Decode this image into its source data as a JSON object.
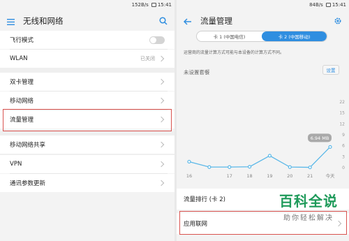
{
  "left": {
    "status": {
      "speed": "152B/s",
      "time": "15:41"
    },
    "title": "无线和网络",
    "rows": [
      {
        "label": "飞行模式",
        "kind": "toggle"
      },
      {
        "label": "WLAN",
        "value": "已关闭"
      },
      {
        "label": "双卡管理"
      },
      {
        "label": "移动网络"
      },
      {
        "label": "流量管理",
        "highlighted": true
      },
      {
        "label": "移动网络共享"
      },
      {
        "label": "VPN"
      },
      {
        "label": "通讯参数更新"
      }
    ]
  },
  "right": {
    "status": {
      "speed": "84B/s",
      "time": "15:41"
    },
    "title": "流量管理",
    "tabs": [
      {
        "label": "卡 1 (中国电信)",
        "active": false
      },
      {
        "label": "卡 2 (中国移动)",
        "active": true
      }
    ],
    "description": "运营商的流量计算方式可能与本设备的计算方式不同。",
    "no_plan": "未设置套餐",
    "set_button": "设置",
    "ranking": "流量排行 (卡 2)",
    "app_network": "应用联网"
  },
  "chart_data": {
    "type": "line",
    "x": [
      "16",
      "17",
      "18",
      "19",
      "20",
      "21",
      "今天"
    ],
    "values": [
      2,
      0.2,
      0.2,
      0.3,
      4,
      0.2,
      0.1,
      6.94
    ],
    "point_labels": [
      "16",
      "",
      "17",
      "18",
      "19",
      "20",
      "21",
      "今天"
    ],
    "yticks": [
      "22",
      "15",
      "12",
      "9",
      "6",
      "3",
      "0"
    ],
    "ylim": [
      0,
      22
    ],
    "last_label": "6.94 MB",
    "color": "#5bb8e8"
  },
  "watermark": {
    "title": "百科全说",
    "subtitle": "助你轻松解决"
  }
}
